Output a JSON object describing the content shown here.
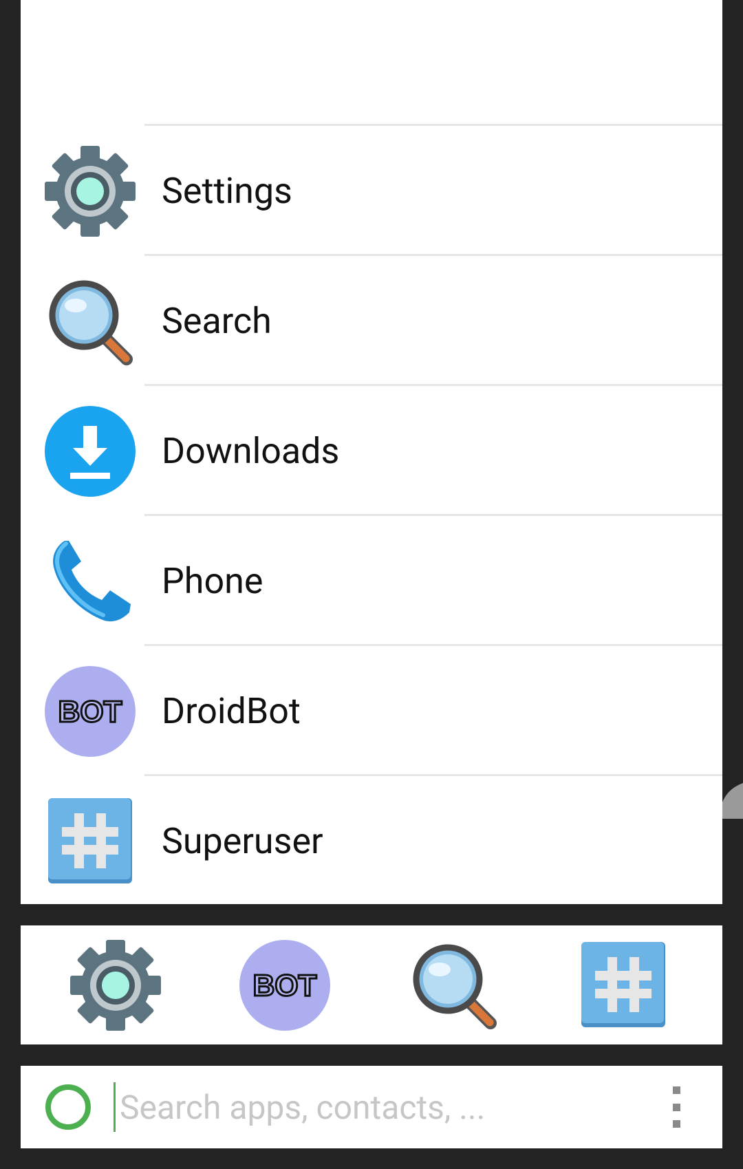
{
  "app_list": {
    "items": [
      {
        "label": "Settings",
        "icon": "settings-icon"
      },
      {
        "label": "Search",
        "icon": "search-app-icon"
      },
      {
        "label": "Downloads",
        "icon": "downloads-icon"
      },
      {
        "label": "Phone",
        "icon": "phone-icon"
      },
      {
        "label": "DroidBot",
        "icon": "droidbot-icon"
      },
      {
        "label": "Superuser",
        "icon": "superuser-icon"
      }
    ]
  },
  "favorites": {
    "items": [
      {
        "icon": "settings-icon"
      },
      {
        "icon": "droidbot-icon"
      },
      {
        "icon": "search-app-icon"
      },
      {
        "icon": "superuser-icon"
      }
    ]
  },
  "search": {
    "placeholder": "Search apps, contacts, ...",
    "value": ""
  },
  "colors": {
    "background": "#232323",
    "panel": "#ffffff",
    "accent_green": "#4caf50",
    "downloads_blue": "#1aa3ee",
    "droidbot_purple": "#acaeef",
    "superuser_blue": "#6cb4e6"
  }
}
